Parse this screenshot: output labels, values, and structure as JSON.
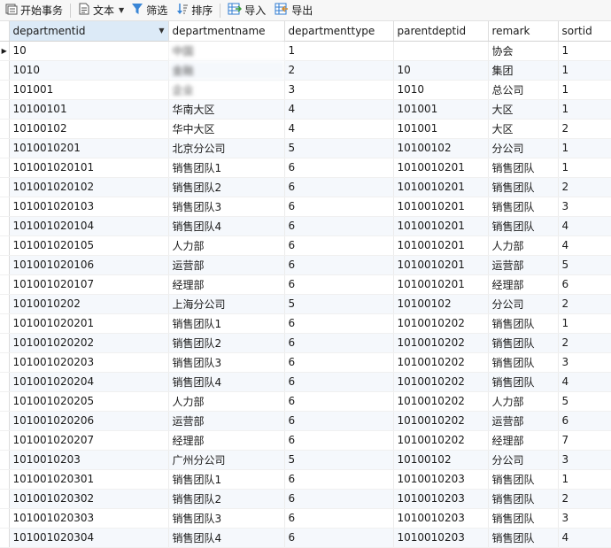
{
  "toolbar": {
    "begin_transaction": "开始事务",
    "text": "文本",
    "filter": "筛选",
    "sort": "排序",
    "import": "导入",
    "export": "导出"
  },
  "columns": [
    "departmentid",
    "departmentname",
    "departmenttype",
    "parentdeptid",
    "remark",
    "sortid"
  ],
  "rows": [
    [
      "10",
      "中国",
      "1",
      "",
      "协会",
      "1"
    ],
    [
      "1010",
      "金融",
      "2",
      "10",
      "集团",
      "1"
    ],
    [
      "101001",
      "企业",
      "3",
      "1010",
      "总公司",
      "1"
    ],
    [
      "10100101",
      "华南大区",
      "4",
      "101001",
      "大区",
      "1"
    ],
    [
      "10100102",
      "华中大区",
      "4",
      "101001",
      "大区",
      "2"
    ],
    [
      "1010010201",
      "北京分公司",
      "5",
      "10100102",
      "分公司",
      "1"
    ],
    [
      "101001020101",
      "销售团队1",
      "6",
      "1010010201",
      "销售团队",
      "1"
    ],
    [
      "101001020102",
      "销售团队2",
      "6",
      "1010010201",
      "销售团队",
      "2"
    ],
    [
      "101001020103",
      "销售团队3",
      "6",
      "1010010201",
      "销售团队",
      "3"
    ],
    [
      "101001020104",
      "销售团队4",
      "6",
      "1010010201",
      "销售团队",
      "4"
    ],
    [
      "101001020105",
      "人力部",
      "6",
      "1010010201",
      "人力部",
      "4"
    ],
    [
      "101001020106",
      "运营部",
      "6",
      "1010010201",
      " 运营部",
      "5"
    ],
    [
      "101001020107",
      "经理部",
      "6",
      "1010010201",
      "经理部",
      "6"
    ],
    [
      "1010010202",
      "上海分公司",
      "5",
      "10100102",
      "分公司",
      "2"
    ],
    [
      "101001020201",
      "销售团队1",
      "6",
      "1010010202",
      "销售团队",
      "1"
    ],
    [
      "101001020202",
      "销售团队2",
      "6",
      "1010010202",
      "销售团队",
      "2"
    ],
    [
      "101001020203",
      "销售团队3",
      "6",
      "1010010202",
      "销售团队",
      "3"
    ],
    [
      "101001020204",
      "销售团队4",
      "6",
      "1010010202",
      "销售团队",
      "4"
    ],
    [
      "101001020205",
      "人力部",
      "6",
      "1010010202",
      "人力部",
      "5"
    ],
    [
      "101001020206",
      "运营部",
      "6",
      "1010010202",
      "运营部",
      "6"
    ],
    [
      "101001020207",
      "经理部",
      "6",
      "1010010202",
      "经理部",
      "7"
    ],
    [
      "1010010203",
      "广州分公司",
      "5",
      "10100102",
      "分公司",
      "3"
    ],
    [
      "101001020301",
      "销售团队1",
      "6",
      "1010010203",
      "销售团队",
      "1"
    ],
    [
      "101001020302",
      "销售团队2",
      "6",
      "1010010203",
      "销售团队",
      "2"
    ],
    [
      "101001020303",
      "销售团队3",
      "6",
      "1010010203",
      "销售团队",
      "3"
    ],
    [
      "101001020304",
      "销售团队4",
      "6",
      "1010010203",
      "销售团队",
      "4"
    ]
  ],
  "icons": {
    "begin_transaction": "transaction-icon",
    "text": "text-doc-icon",
    "filter": "funnel-icon",
    "sort": "sort-icon",
    "import": "import-table-icon",
    "export": "export-table-icon"
  },
  "colors": {
    "funnel": "#3a86d6",
    "sort": "#3a86d6",
    "import_export": "#2f7bd0",
    "active_header": "#dceaf7",
    "alt_row": "#f5f8fc"
  }
}
